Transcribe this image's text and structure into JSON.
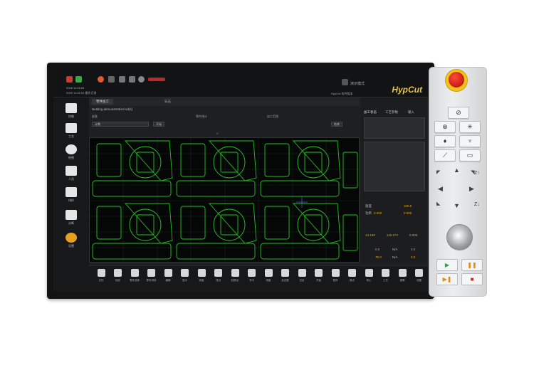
{
  "topbar": {
    "status_line_1": "0008 11:26:53",
    "status_line_2": "0009 11:26:53 操作正常",
    "mode_label": "演示模式",
    "version_label": "HypCut 软件版本",
    "brand": "HypCut"
  },
  "sidebar": {
    "items": [
      {
        "label": "控制"
      },
      {
        "label": "工艺"
      },
      {
        "label": "绘图"
      },
      {
        "label": "人员"
      },
      {
        "label": "排样"
      },
      {
        "label": "诊断"
      },
      {
        "label": "设置"
      }
    ]
  },
  "tabs": [
    {
      "label": "零件加工"
    },
    {
      "label": "日志"
    }
  ],
  "file": {
    "name": "Nesting demonstration.lxd(s)"
  },
  "toolbar": {
    "item_1": "嵌套",
    "item_2": "零件统计",
    "start_btn": "开始",
    "end_btn": "结束",
    "field_1": "加工范围",
    "field_2": "计数"
  },
  "canvas": {
    "coord_label": "X",
    "grid": "on"
  },
  "right_panel": {
    "header_1": "加工状态",
    "header_2": "工艺参数",
    "header_3": "输入",
    "label_speed": "速度",
    "value_speed": "100.0",
    "label_power": "功率",
    "value_power": "0.000",
    "value_power_2": "0.000",
    "coord_x": "14.168",
    "coord_y": "116.274",
    "coord_z": "0.000",
    "value_a": "0.0",
    "value_b": "N/A",
    "value_c": "0.0",
    "value_d": "75.0",
    "value_e": "N/A",
    "value_f": "0.0"
  },
  "bottombar": {
    "items": [
      {
        "label": "文件"
      },
      {
        "label": "保存"
      },
      {
        "label": "零件选择"
      },
      {
        "label": "零件排序"
      },
      {
        "label": "编辑"
      },
      {
        "label": "显示"
      },
      {
        "label": "测量"
      },
      {
        "label": "寻边"
      },
      {
        "label": "回原点"
      },
      {
        "label": "寻中"
      },
      {
        "label": "测量"
      },
      {
        "label": "走边框"
      },
      {
        "label": "空走"
      },
      {
        "label": "开始"
      },
      {
        "label": "暂停"
      },
      {
        "label": "断点"
      },
      {
        "label": "停止"
      },
      {
        "label": "工艺"
      },
      {
        "label": "报警"
      },
      {
        "label": "设置"
      }
    ]
  },
  "console": {
    "keys": [
      {
        "name": "laser-key",
        "glyph": "⊘"
      },
      {
        "name": "target-key",
        "glyph": "⊕"
      },
      {
        "name": "light-key",
        "glyph": "✳"
      },
      {
        "name": "nozzle-key",
        "glyph": "♦"
      },
      {
        "name": "gas-key",
        "glyph": "♆"
      },
      {
        "name": "beam-key",
        "glyph": "⟋"
      },
      {
        "name": "frame-key",
        "glyph": "▭"
      }
    ],
    "z_up": "Z↑",
    "z_down": "Z↓",
    "play_glyph": "▶",
    "pause_glyph": "❚❚",
    "resume_glyph": "▶❚",
    "stop_glyph": "■"
  },
  "colors": {
    "screen_bg": "#1d1f21",
    "canvas_bg": "#050606",
    "part_outline": "#25c025",
    "brand": "#e8c44a",
    "estop": "#d72a1c",
    "estop_ring": "#f0c419",
    "play": "#2ea043",
    "stop": "#d7281d"
  }
}
